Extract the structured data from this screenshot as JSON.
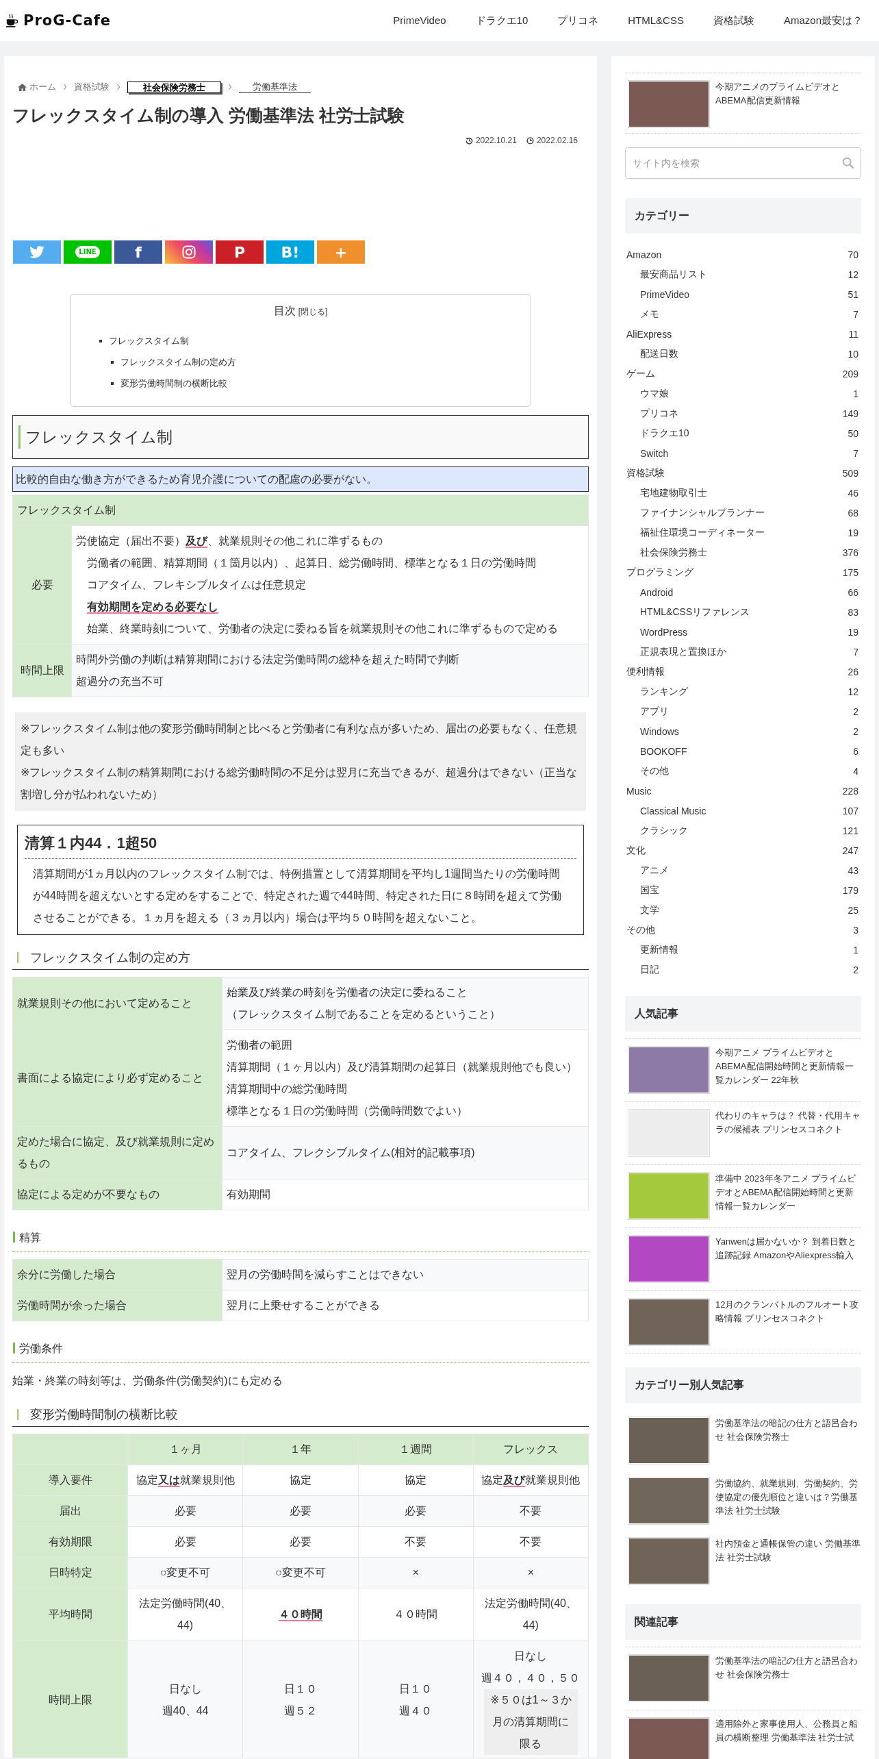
{
  "header": {
    "logo": "ProG-Cafe",
    "nav": [
      "PrimeVideo",
      "ドラクエ10",
      "プリコネ",
      "HTML&CSS",
      "資格試験",
      "Amazon最安は？"
    ]
  },
  "article": {
    "breadcrumb": [
      {
        "label": "ホーム",
        "kind": "home"
      },
      {
        "label": "資格試験",
        "kind": "plain"
      },
      {
        "label": "社会保険労務士",
        "kind": "boxed"
      },
      {
        "label": "労働基準法",
        "kind": "underlined"
      }
    ],
    "title": "フレックスタイム制の導入 労働基準法 社労士試験",
    "updated": "2022.10.21",
    "published": "2022.02.16",
    "share_buttons": [
      {
        "kind": "twitter"
      },
      {
        "kind": "line",
        "label": "LINE"
      },
      {
        "kind": "facebook",
        "label": "f"
      },
      {
        "kind": "instagram"
      },
      {
        "kind": "pinterest",
        "label": "P"
      },
      {
        "kind": "hatena",
        "label": "B!"
      },
      {
        "kind": "more",
        "label": "+"
      }
    ],
    "toc": {
      "title": "目次",
      "toggle": "[閉じる]",
      "items": [
        {
          "label": "フレックスタイム制",
          "children": [
            {
              "label": "フレックスタイム制の定め方"
            },
            {
              "label": "変形労働時間制の横断比較"
            }
          ]
        }
      ]
    },
    "blocks": [
      {
        "kind": "heading2",
        "text": "フレックスタイム制"
      },
      {
        "kind": "callout",
        "text": "比較的自由な働き方ができるため育児介護についての配慮の必要がない。"
      },
      {
        "kind": "spec_table",
        "header": "フレックスタイム制",
        "rows": [
          {
            "head": "必要",
            "lines": [
              {
                "text": "労使協定（届出不要）**及び**、就業規則その他これに準ずるもの",
                "children": [
                  {
                    "text": "労働者の範囲、精算期間（１箇月以内）、起算日、総労働時間、標準となる１日の労働時間"
                  },
                  {
                    "text": "コアタイム、フレキシブルタイムは任意規定"
                  },
                  {
                    "text": "有効期間を定める必要なし",
                    "strong": true
                  },
                  {
                    "text": "始業、終業時刻について、労働者の決定に委ねる旨を就業規則その他これに準ずるもので定める"
                  }
                ]
              }
            ]
          },
          {
            "head": "時間上限",
            "lines": [
              {
                "text": "時間外労働の判断は精算期間における法定労働時間の総枠を超えた時間で判断"
              },
              {
                "text": "超過分の充当不可"
              }
            ]
          }
        ]
      },
      {
        "kind": "remark",
        "lines": [
          "※フレックスタイム制は他の変形労働時間制と比べると労働者に有利な点が多いため、届出の必要もなく、任意規定も多い",
          "※フレックスタイム制の精算期間における総労働時間の不足分は翌月に充当できるが、超過分はできない（正当な割増し分が払われないため）"
        ]
      },
      {
        "kind": "summary",
        "title": "清算１内44．1超50",
        "text": "清算期間が1ヵ月以内のフレックスタイム制では、特例措置として清算期間を平均し1週間当たりの労働時間が44時間を超えないとする定めをすることで、特定された週で44時間、特定された日に８時間を超えて労働させることができる。１ヵ月を超える（３ヵ月以内）場合は平均５０時間を超えないこと。"
      },
      {
        "kind": "heading3",
        "text": "フレックスタイム制の定め方"
      },
      {
        "kind": "term_table",
        "rows": [
          {
            "head": "就業規則その他において定めること",
            "lines": [
              "始業及び終業の時刻を労働者の決定に委ねること",
              "（フレックスタイム制であることを定めるということ）"
            ]
          },
          {
            "head": "書面による協定により必ず定めること",
            "lines": [
              "労働者の範囲",
              "清算期間（１ヶ月以内）及び清算期間の起算日（就業規則他でも良い）",
              "清算期間中の総労働時間",
              "標準となる１日の労働時間（労働時間数でよい）"
            ]
          },
          {
            "head": "定めた場合に協定、及び就業規則に定めるもの",
            "lines": [
              "コアタイム、フレクシブルタイム(相対的記載事項)"
            ]
          },
          {
            "head": "協定による定めが不要なもの",
            "lines": [
              "有効期間"
            ]
          }
        ]
      },
      {
        "kind": "heading4",
        "text": "精算"
      },
      {
        "kind": "term_table",
        "rows": [
          {
            "head": "余分に労働した場合",
            "lines": [
              "翌月の労働時間を減らすことはできない"
            ]
          },
          {
            "head": "労働時間が余った場合",
            "lines": [
              "翌月に上乗せすることができる"
            ]
          }
        ]
      },
      {
        "kind": "heading4",
        "text": "労働条件"
      },
      {
        "kind": "paragraph",
        "text": "始業・終業の時刻等は、労働条件(労働契約)にも定める"
      },
      {
        "kind": "heading3",
        "text": "変形労働時間制の横断比較"
      },
      {
        "kind": "compare_table",
        "columns": [
          "１ヶ月",
          "１年",
          "１週間",
          "フレックス"
        ],
        "rows": [
          {
            "head": "導入要件",
            "cells": [
              "協定**又は**就業規則他",
              "協定",
              "協定",
              "協定**及び**就業規則他"
            ]
          },
          {
            "head": "届出",
            "cells": [
              "必要",
              "必要",
              "必要",
              "不要"
            ]
          },
          {
            "head": "有効期限",
            "cells": [
              "必要",
              "必要",
              "不要",
              "不要"
            ]
          },
          {
            "head": "日時特定",
            "cells": [
              "○変更不可",
              "○変更不可",
              "×",
              "×"
            ]
          },
          {
            "head": "平均時間",
            "cells": [
              "法定労働時間(40、44)",
              {
                "lines": [
                  "４０時間"
                ],
                "strong": true
              },
              "４０時間",
              "法定労働時間(40、44)"
            ]
          },
          {
            "head": "時間上限",
            "cells": [
              {
                "lines": [
                  "日なし",
                  "週40、44"
                ]
              },
              {
                "lines": [
                  "日１０",
                  "週５２"
                ]
              },
              {
                "lines": [
                  "日１０",
                  "週４０"
                ]
              },
              {
                "lines": [
                  "日なし",
                  "週４０，４０，５０"
                ],
                "note": "※５０は1～３か月の清算期間に限る"
              }
            ]
          }
        ]
      }
    ]
  },
  "sidebar": {
    "featured": [
      {
        "title": "今期アニメのプライムビデオとABEMA配信更新情報"
      }
    ],
    "search": {
      "placeholder": "サイト内を検索"
    },
    "categories": {
      "title": "カテゴリー",
      "items": [
        {
          "label": "Amazon",
          "count": "70",
          "children": [
            {
              "label": "最安商品リスト",
              "count": "12"
            },
            {
              "label": "PrimeVideo",
              "count": "51"
            },
            {
              "label": "メモ",
              "count": "7"
            }
          ]
        },
        {
          "label": "AliExpress",
          "count": "11",
          "children": [
            {
              "label": "配送日数",
              "count": "10"
            }
          ]
        },
        {
          "label": "ゲーム",
          "count": "209",
          "children": [
            {
              "label": "ウマ娘",
              "count": "1"
            },
            {
              "label": "プリコネ",
              "count": "149"
            },
            {
              "label": "ドラクエ10",
              "count": "50"
            },
            {
              "label": "Switch",
              "count": "7"
            }
          ]
        },
        {
          "label": "資格試験",
          "count": "509",
          "children": [
            {
              "label": "宅地建物取引士",
              "count": "46"
            },
            {
              "label": "ファイナンシャルプランナー",
              "count": "68"
            },
            {
              "label": "福祉住環境コーディネーター",
              "count": "19"
            },
            {
              "label": "社会保険労務士",
              "count": "376"
            }
          ]
        },
        {
          "label": "プログラミング",
          "count": "175",
          "children": [
            {
              "label": "Android",
              "count": "66"
            },
            {
              "label": "HTML&CSSリファレンス",
              "count": "83"
            },
            {
              "label": "WordPress",
              "count": "19"
            },
            {
              "label": "正規表現と置換ほか",
              "count": "7"
            }
          ]
        },
        {
          "label": "便利情報",
          "count": "26",
          "children": [
            {
              "label": "ランキング",
              "count": "12"
            },
            {
              "label": "アプリ",
              "count": "2"
            },
            {
              "label": "Windows",
              "count": "2"
            },
            {
              "label": "BOOKOFF",
              "count": "6"
            },
            {
              "label": "その他",
              "count": "4"
            }
          ]
        },
        {
          "label": "Music",
          "count": "228",
          "children": [
            {
              "label": "Classical Music",
              "count": "107"
            },
            {
              "label": "クラシック",
              "count": "121"
            }
          ]
        },
        {
          "label": "文化",
          "count": "247",
          "children": [
            {
              "label": "アニメ",
              "count": "43"
            },
            {
              "label": "国宝",
              "count": "179"
            },
            {
              "label": "文学",
              "count": "25"
            }
          ]
        },
        {
          "label": "その他",
          "count": "3",
          "children": [
            {
              "label": "更新情報",
              "count": "1"
            },
            {
              "label": "日記",
              "count": "2"
            }
          ]
        }
      ]
    },
    "article_lists": [
      {
        "title": "人気記事",
        "articles": [
          {
            "title": "今期アニメ プライムビデオとABEMA配信開始時間と更新情報一覧カレンダー 22年秋"
          },
          {
            "title": "代わりのキャラは？ 代替・代用キャラの候補表 プリンセスコネクト"
          },
          {
            "title": "準備中 2023年冬アニメ プライムビデオとABEMA配信開始時間と更新情報一覧カレンダー"
          },
          {
            "title": "Yanwenは届かないか？ 到着日数と追跡記録 AmazonやAliexpress輸入"
          },
          {
            "title": "12月のクランバトルのフルオート攻略情報 プリンセスコネクト"
          }
        ]
      },
      {
        "title": "カテゴリー別人気記事",
        "articles": [
          {
            "title": "労働基準法の暗記の仕方と語呂合わせ 社会保険労務士"
          },
          {
            "title": "労働協約、就業規則、労働契約、労使協定の優先順位と違いは？労働基準法 社労士試験"
          },
          {
            "title": "社内預金と通帳保管の違い 労働基準法 社労士試験"
          }
        ]
      },
      {
        "title": "関連記事",
        "articles": [
          {
            "title": "労働基準法の暗記の仕方と語呂合わせ 社会保険労務士"
          },
          {
            "title": "適用除外と家事使用人、公務員と船員の横断整理 労働基準法 社労士試"
          }
        ]
      }
    ]
  }
}
